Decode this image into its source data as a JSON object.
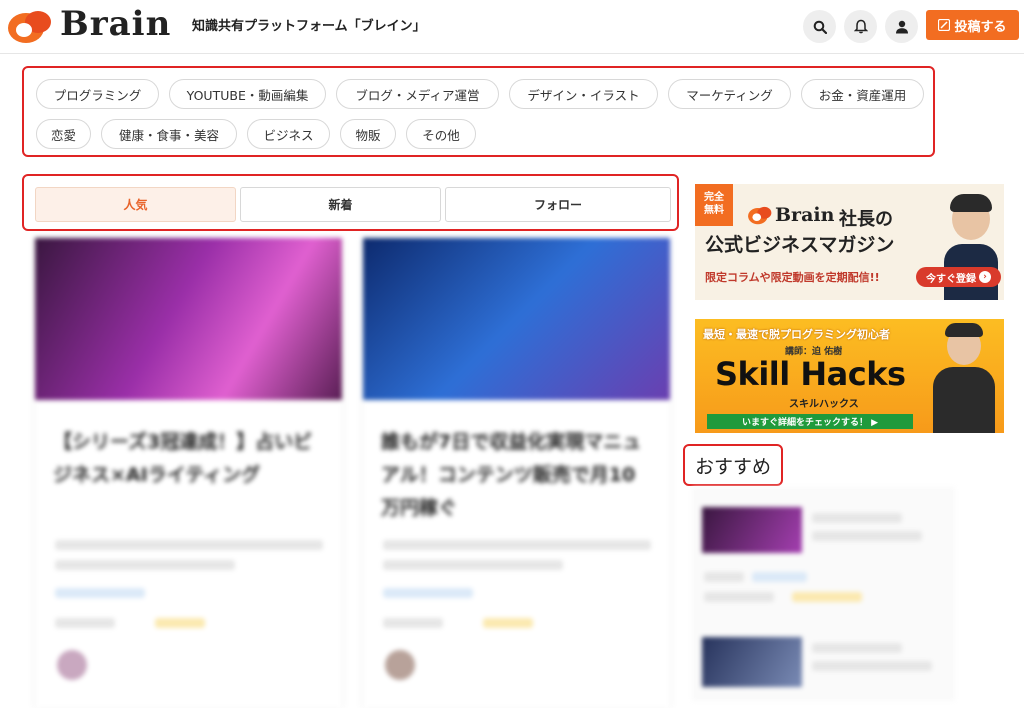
{
  "header": {
    "logo_text": "Brain",
    "tagline": "知識共有プラットフォーム「ブレイン」",
    "post_button": "投稿する",
    "icons": [
      "search-icon",
      "bell-icon",
      "user-icon",
      "pencil-icon"
    ],
    "accent_color": "#f26d21"
  },
  "categories": [
    "プログラミング",
    "YOUTUBE・動画編集",
    "ブログ・メディア運営",
    "デザイン・イラスト",
    "マーケティング",
    "お金・資産運用",
    "恋愛",
    "健康・食事・美容",
    "ビジネス",
    "物販",
    "その他"
  ],
  "tabs": [
    {
      "label": "人気",
      "active": true
    },
    {
      "label": "新着",
      "active": false
    },
    {
      "label": "フォロー",
      "active": false
    }
  ],
  "cards": [
    {
      "title": "【シリーズ3冠達成！】占いビジネス×AIライティング",
      "thumb_colors": [
        "#3a1740",
        "#9a2fa8",
        "#e060d0"
      ]
    },
    {
      "title": "誰もが7日で収益化実現マニュアル！コンテンツ販売で月10万円稼ぐ",
      "thumb_colors": [
        "#0d2a6e",
        "#2e6fd6",
        "#6a3fb0"
      ]
    }
  ],
  "banners": [
    {
      "badge": "完全無料",
      "brand": "Brain",
      "heading_line1": "社長の",
      "heading_line2": "公式ビジネスマガジン",
      "tagline": "限定コラムや限定動画を定期配信!!",
      "button": "今すぐ登録"
    },
    {
      "top_line": "最短・最速で脱プログラミング初心者",
      "instructor": "講師：迫 佑樹",
      "title": "Skill Hacks",
      "subtitle": "スキルハックス",
      "cta": "いますぐ詳細をチェックする！ ▶"
    }
  ],
  "recommend": {
    "heading": "おすすめ"
  },
  "highlight_color": "#e02424"
}
